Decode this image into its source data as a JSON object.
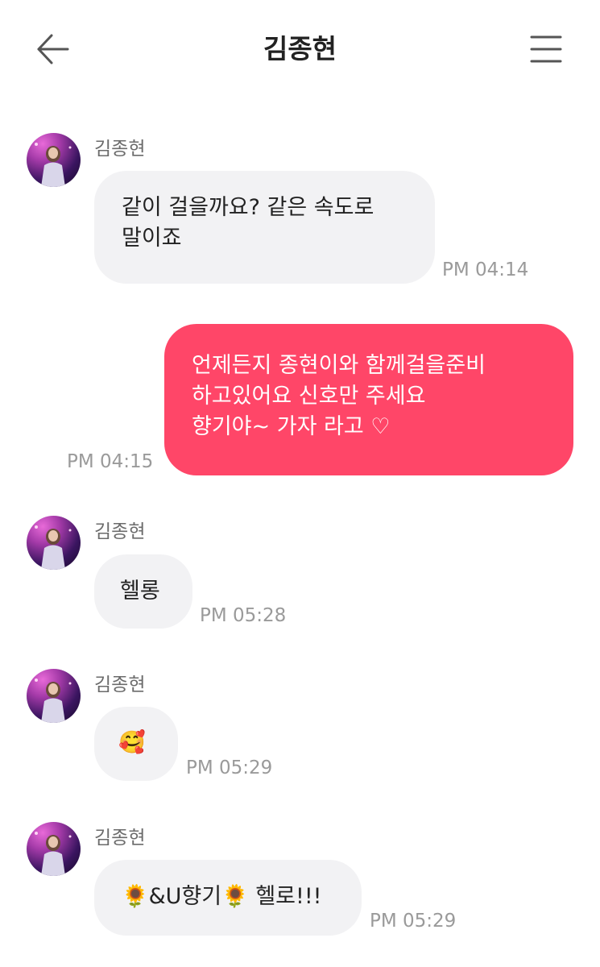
{
  "header": {
    "title": "김종현",
    "back_icon": "arrow-left-icon",
    "menu_icon": "hamburger-menu-icon"
  },
  "colors": {
    "incoming_bubble": "#f2f2f4",
    "outgoing_bubble": "#ff4668",
    "timestamp": "#9a9a9a"
  },
  "messages": [
    {
      "direction": "incoming",
      "sender": "김종현",
      "text": "같이 걸을까요? 같은 속도로\n말이죠",
      "time": "PM 04:14"
    },
    {
      "direction": "outgoing",
      "text": "언제든지 종현이와  함께걸을준비\n하고있어요   신호만 주세요\n향기야~ 가자 라고 ♡",
      "time": "PM 04:15"
    },
    {
      "direction": "incoming",
      "sender": "김종현",
      "text": "헬롱",
      "time": "PM 05:28"
    },
    {
      "direction": "incoming",
      "sender": "김종현",
      "text": "🥰",
      "time": "PM 05:29"
    },
    {
      "direction": "incoming",
      "sender": "김종현",
      "text": "🌻&U향기🌻 헬로!!!",
      "time": "PM 05:29"
    }
  ]
}
